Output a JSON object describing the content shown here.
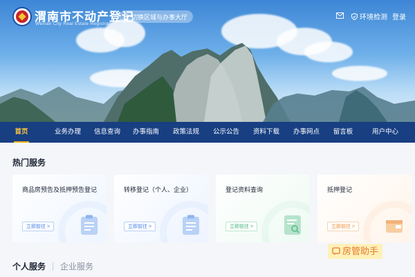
{
  "header": {
    "title": "渭南市不动产登记",
    "subtitle": "Weinan City Real Estate Registration",
    "region_placeholder": "切换区域与办事大厅",
    "check_label": "环境检测",
    "login_label": "登录",
    "icons": [
      "location-pin-icon",
      "mail-icon",
      "shield-check-icon"
    ]
  },
  "nav": {
    "items": [
      {
        "label": "首页",
        "active": true
      },
      {
        "label": "业务办理"
      },
      {
        "label": "信息查询"
      },
      {
        "label": "办事指南"
      },
      {
        "label": "政策法规"
      },
      {
        "label": "公示公告"
      },
      {
        "label": "资料下载"
      },
      {
        "label": "办事网点"
      },
      {
        "label": "留言板"
      },
      {
        "label": "用户中心"
      }
    ],
    "bg_color": "#173f82",
    "active_color": "#f2b21a"
  },
  "hot_services": {
    "title": "热门服务",
    "cards": [
      {
        "title": "商品房预告及抵押预告登记",
        "action": "立即前往 >",
        "icon": "clipboard-icon",
        "accent": "#3f7ee2"
      },
      {
        "title": "转移登记（个人、企业）",
        "action": "立即前往 >",
        "icon": "clipboard-icon",
        "accent": "#3f7ee2"
      },
      {
        "title": "登记资料查询",
        "action": "立即前往 >",
        "icon": "document-search-icon",
        "accent": "#3fb07a"
      },
      {
        "title": "抵押登记",
        "action": "立即前往 >",
        "icon": "wallet-icon",
        "accent": "#ec8a2d"
      }
    ]
  },
  "assistant_badge": {
    "label": "房管助手",
    "icon": "assistant-icon"
  },
  "service_tabs": [
    {
      "label": "个人服务",
      "active": true
    },
    {
      "label": "企业服务",
      "active": false
    }
  ]
}
